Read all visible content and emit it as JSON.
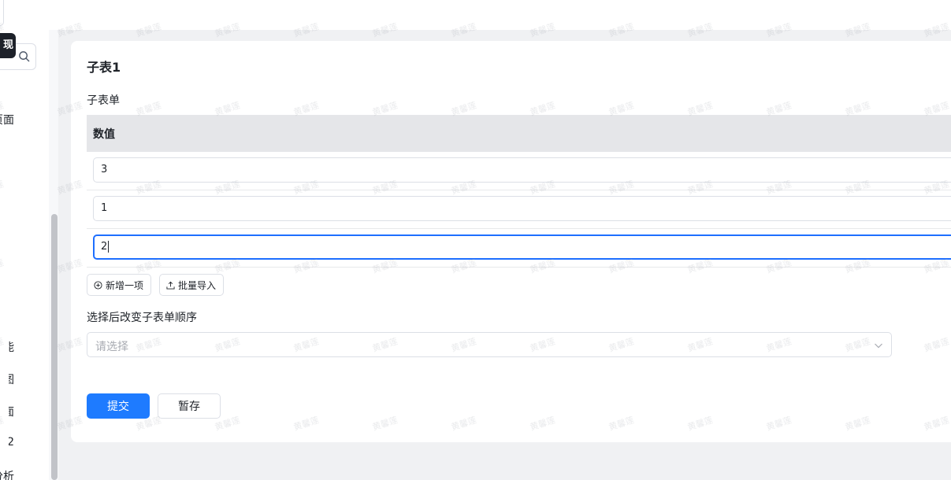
{
  "tooltip": {
    "text": "现"
  },
  "sidebar": {
    "items": [
      {
        "label": "页面"
      },
      {
        "label": "能"
      },
      {
        "label": "图"
      },
      {
        "label": "面"
      },
      {
        "label": "2"
      },
      {
        "label": "分析"
      }
    ]
  },
  "form": {
    "title": "子表1",
    "subtable_label": "子表单",
    "column_header": "数值",
    "rows": [
      {
        "value": "3"
      },
      {
        "value": "1"
      },
      {
        "value": "2"
      }
    ],
    "add_item_label": "新增一项",
    "batch_import_label": "批量导入",
    "reorder_label": "选择后改变子表单顺序",
    "select_placeholder": "请选择",
    "submit_label": "提交",
    "save_draft_label": "暂存"
  },
  "watermark": {
    "text": "黄馨莲"
  },
  "colors": {
    "primary": "#1e7bff",
    "focus": "#1e6fff",
    "header_bg": "#e5e6e9"
  },
  "icons": [
    "search-icon",
    "plus-circle-icon",
    "upload-icon",
    "chevron-down-icon"
  ]
}
